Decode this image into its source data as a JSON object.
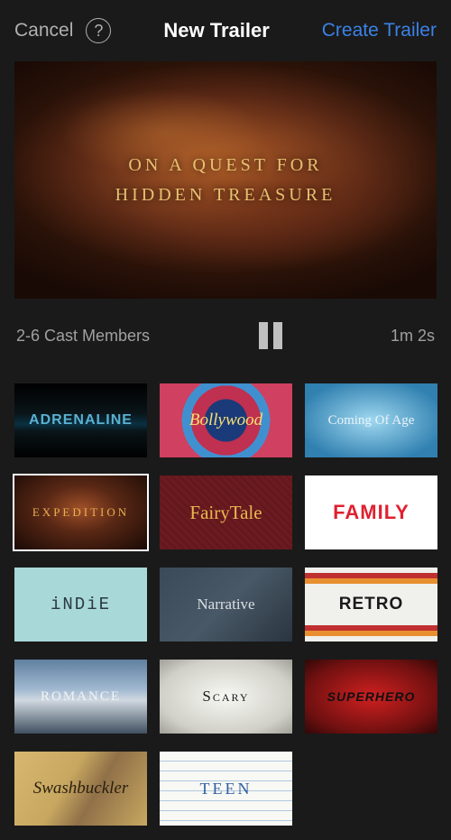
{
  "header": {
    "cancel": "Cancel",
    "title": "New Trailer",
    "create": "Create Trailer"
  },
  "preview": {
    "line1": "ON A QUEST FOR",
    "line2": "HIDDEN TREASURE"
  },
  "info": {
    "cast": "2-6 Cast Members",
    "duration": "1m 2s"
  },
  "themes": [
    {
      "id": "adrenaline",
      "label": "Adrenaline",
      "cls": "t-adrenaline",
      "selected": false
    },
    {
      "id": "bollywood",
      "label": "Bollywood",
      "cls": "t-bollywood",
      "selected": false
    },
    {
      "id": "comingofage",
      "label": "Coming Of Age",
      "cls": "t-comingofage",
      "selected": false
    },
    {
      "id": "expedition",
      "label": "EXPEDITION",
      "cls": "t-expedition",
      "selected": true
    },
    {
      "id": "fairytale",
      "label": "FairyTale",
      "cls": "t-fairytale",
      "selected": false
    },
    {
      "id": "family",
      "label": "FAMILY",
      "cls": "t-family",
      "selected": false
    },
    {
      "id": "indie",
      "label": "iNDiE",
      "cls": "t-indie",
      "selected": false
    },
    {
      "id": "narrative",
      "label": "Narrative",
      "cls": "t-narrative",
      "selected": false
    },
    {
      "id": "retro",
      "label": "RETRO",
      "cls": "t-retro",
      "selected": false
    },
    {
      "id": "romance",
      "label": "ROMANCE",
      "cls": "t-romance",
      "selected": false
    },
    {
      "id": "scary",
      "label": "Scary",
      "cls": "t-scary",
      "selected": false
    },
    {
      "id": "superhero",
      "label": "SUPERHERO",
      "cls": "t-superhero",
      "selected": false
    },
    {
      "id": "swashbuckler",
      "label": "Swashbuckler",
      "cls": "t-swashbuckler",
      "selected": false
    },
    {
      "id": "teen",
      "label": "Teen",
      "cls": "t-teen",
      "selected": false
    }
  ]
}
